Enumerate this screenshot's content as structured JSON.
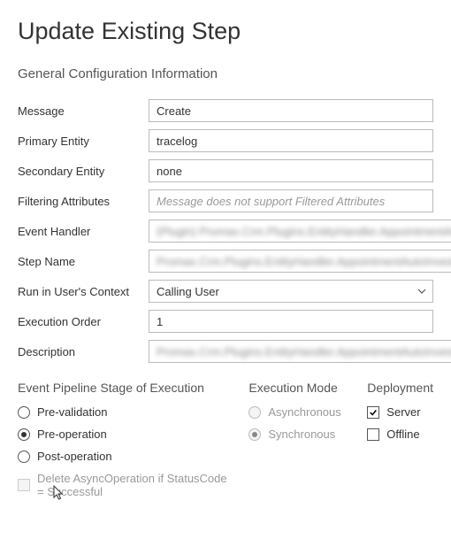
{
  "title": "Update Existing Step",
  "section_title": "General Configuration Information",
  "fields": {
    "message": {
      "label": "Message",
      "value": "Create"
    },
    "primary_entity": {
      "label": "Primary Entity",
      "value": "tracelog"
    },
    "secondary_entity": {
      "label": "Secondary Entity",
      "value": "none"
    },
    "filtering_attributes": {
      "label": "Filtering Attributes",
      "value": "",
      "placeholder": "Message does not support Filtered Attributes"
    },
    "event_handler": {
      "label": "Event Handler",
      "value": "(Plugin) Promax.Crm.Plugins.EntityHandler.AppointmentAuto"
    },
    "step_name": {
      "label": "Step Name",
      "value": "Promax.Crm.Plugins.EntityHandler.AppointmentAutoInvestTimes:"
    },
    "run_context": {
      "label": "Run in User's Context",
      "value": "Calling User"
    },
    "execution_order": {
      "label": "Execution Order",
      "value": "1"
    },
    "description": {
      "label": "Description",
      "value": "Promax.Crm.Plugins.EntityHandler.AppointmentAutoInvestTimes:"
    }
  },
  "pipeline": {
    "title": "Event Pipeline Stage of Execution",
    "options": {
      "pre_validation": "Pre-validation",
      "pre_operation": "Pre-operation",
      "post_operation": "Post-operation"
    },
    "selected": "pre_operation",
    "delete_async_label": "Delete AsyncOperation if StatusCode = Successful"
  },
  "mode": {
    "title": "Execution Mode",
    "options": {
      "async": "Asynchronous",
      "sync": "Synchronous"
    },
    "selected": "sync"
  },
  "deployment": {
    "title": "Deployment",
    "options": {
      "server": "Server",
      "offline": "Offline"
    },
    "server_checked": true,
    "offline_checked": false
  }
}
